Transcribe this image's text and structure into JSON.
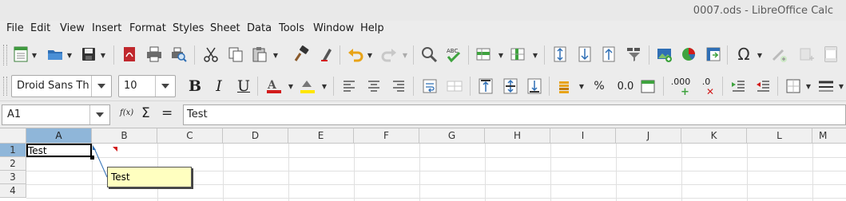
{
  "window": {
    "title": "0007.ods - LibreOffice Calc"
  },
  "menu": [
    "File",
    "Edit",
    "View",
    "Insert",
    "Format",
    "Styles",
    "Sheet",
    "Data",
    "Tools",
    "Window",
    "Help"
  ],
  "font": {
    "name": "Droid Sans Tha",
    "size": "10"
  },
  "format_labels": {
    "bold": "B",
    "italic": "I",
    "underline": "U",
    "percent": "%",
    "number": "0.0",
    "add_decimal": ".000",
    "del_decimal": ".0"
  },
  "formula_bar": {
    "cell_ref": "A1",
    "fx": "f(x)",
    "sum": "Σ",
    "equals": "=",
    "content": "Test"
  },
  "columns": [
    "A",
    "B",
    "C",
    "D",
    "E",
    "F",
    "G",
    "H",
    "I",
    "J",
    "K",
    "L",
    "M"
  ],
  "rows": [
    "1",
    "2",
    "3",
    "4"
  ],
  "cells": {
    "A1": "Test"
  },
  "comment": {
    "text": "Test"
  },
  "colors": {
    "selection_header": "#8fb6d9",
    "comment_bg": "#ffffc0",
    "comment_marker": "#d21b1b",
    "font_color_bar": "#d21b1b",
    "highlight_bar": "#ffe600"
  }
}
